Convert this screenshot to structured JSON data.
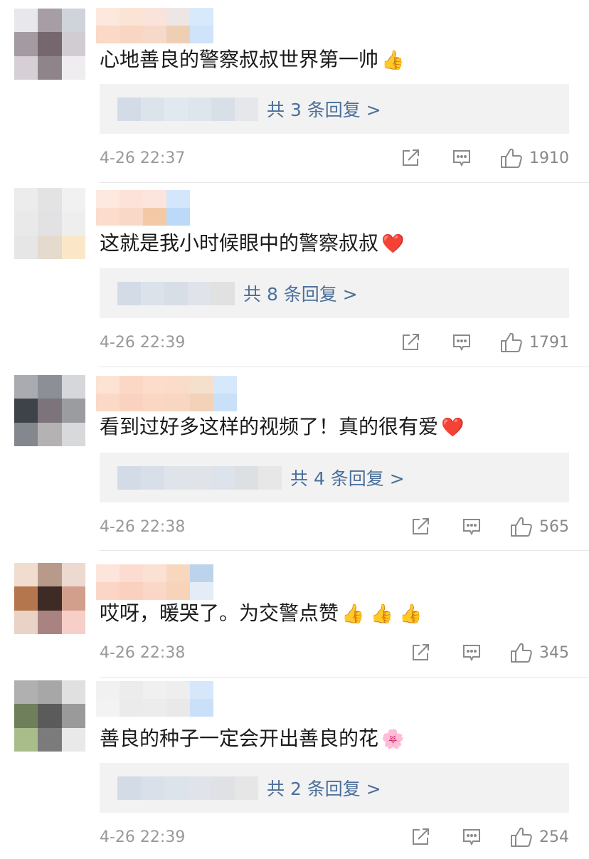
{
  "comments": [
    {
      "text": "心地善良的警察叔叔世界第一帅",
      "emoji": "👍",
      "reply_label": "共 3 条回复 >",
      "time": "4-26 22:37",
      "likes": "1910",
      "avatar_colors": [
        "#e8e8ec",
        "#a69da5",
        "#cfd3da",
        "#a39aa2",
        "#76676f",
        "#d0ccd2",
        "#d6d0d6",
        "#8f8489",
        "#efedf0"
      ],
      "name_colors": [
        "#fce8dc",
        "#fbe3d6",
        "#f9e3da",
        "#ece6e4",
        "#d7e9fb",
        "#fad9c6",
        "#f9d6c4",
        "#f7d9c9",
        "#efcfb3",
        "#cfe3fb"
      ],
      "reply_blur": [
        "#d3dbe6",
        "#dce3eb",
        "#e2e8ef",
        "#dfe5ec",
        "#d9dfe7",
        "#e5e7ea"
      ]
    },
    {
      "text": "这就是我小时候眼中的警察叔叔",
      "emoji": "❤️",
      "reply_label": "共 8 条回复 >",
      "time": "4-26 22:39",
      "likes": "1791",
      "avatar_colors": [
        "#ececec",
        "#e3e3e3",
        "#f1f1f1",
        "#e9e9ea",
        "#e2e2e4",
        "#eeeeef",
        "#e6e6e6",
        "#e4dacd",
        "#fbe7c7"
      ],
      "name_colors": [
        "#fde9e0",
        "#fce2d8",
        "#fbe5dc",
        "#d3e6fb",
        "#fcdccc",
        "#fad8c7",
        "#f3c9a6",
        "#bcd9f7"
      ],
      "reply_blur": [
        "#d3dbe6",
        "#dce2ea",
        "#d8dee6",
        "#e0e4ea",
        "#e1e1e1"
      ]
    },
    {
      "text": "看到过好多这样的视频了！真的很有爱",
      "emoji": "❤️",
      "reply_label": "共 4 条回复 >",
      "time": "4-26 22:38",
      "likes": "565",
      "avatar_colors": [
        "#a9abb0",
        "#8c8f96",
        "#d5d7da",
        "#3e4249",
        "#7c747a",
        "#9a9ca0",
        "#84878d",
        "#b5b2b4",
        "#d8d9db"
      ],
      "name_colors": [
        "#fce3d3",
        "#fbd8c6",
        "#fcdccb",
        "#fbdcc9",
        "#f5dfcd",
        "#d6e8fb",
        "#fad9c6",
        "#f9d3bf",
        "#fad6c3",
        "#f7d6c2",
        "#f2d2b9",
        "#c9e0f8"
      ],
      "reply_blur": [
        "#d3dbe6",
        "#d8dfe8",
        "#dfe4ea",
        "#e0e4e9",
        "#dde3ea",
        "#dde0e3",
        "#e7e7e7"
      ]
    },
    {
      "text": "哎呀，暖哭了。为交警点赞",
      "emoji": "👍 👍 👍",
      "reply_label": "",
      "time": "4-26 22:38",
      "likes": "345",
      "avatar_colors": [
        "#f0ddd0",
        "#b79a8a",
        "#ecd9cf",
        "#b4764d",
        "#3f2b26",
        "#d29f8c",
        "#e9d2c6",
        "#a88382",
        "#f7cfc8"
      ],
      "name_colors": [
        "#fde5dc",
        "#fcdcd0",
        "#fbe0d4",
        "#f8d7bf",
        "#bcd3ec",
        "#fbd6c7",
        "#fad0bf",
        "#fad7c6",
        "#f6d3b9",
        "#e3ecf7"
      ],
      "reply_blur": []
    },
    {
      "text": "善良的种子一定会开出善良的花",
      "emoji": "🌸",
      "reply_label": "共 2 条回复 >",
      "time": "4-26 22:39",
      "likes": "254",
      "avatar_colors": [
        "#b0b0b0",
        "#a7a7a7",
        "#e0e0e0",
        "#6f7f5b",
        "#5b5b5b",
        "#9a9a9a",
        "#a9bd8a",
        "#7b7b7b",
        "#e9e9e9"
      ],
      "name_colors": [
        "#f1f1f1",
        "#ececec",
        "#f0f0f0",
        "#eeeeee",
        "#d6e7fa",
        "#f3f3f3",
        "#ebebeb",
        "#ececec",
        "#e9e9e9",
        "#c9e0f8"
      ],
      "reply_blur": [
        "#d3dbe6",
        "#d9e0e9",
        "#dde3ea",
        "#e0e4ea",
        "#dfe1e4",
        "#e6e6e6"
      ]
    }
  ]
}
